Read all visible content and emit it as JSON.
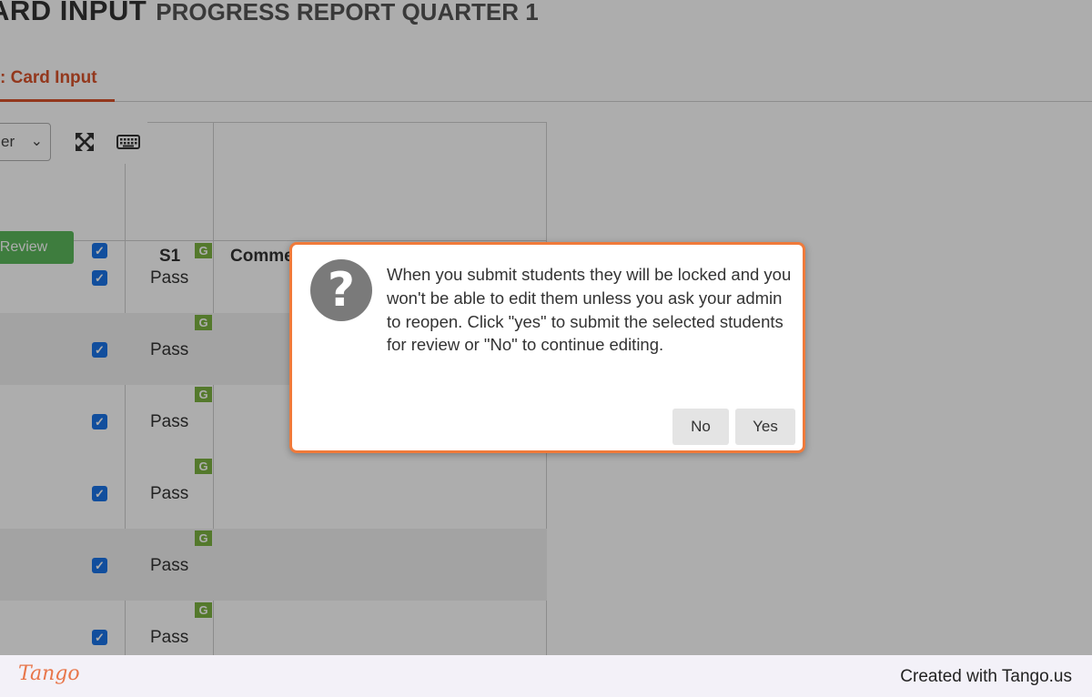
{
  "page": {
    "title_main": "ARD INPUT",
    "title_sub": "PROGRESS REPORT QUARTER 1"
  },
  "tabs": {
    "active_label": ": Card Input"
  },
  "toolbar": {
    "select_value": "er",
    "expand_icon": "expand-icon",
    "keyboard_icon": "keyboard-icon"
  },
  "grid": {
    "review_button_label": "r Review",
    "columns": [
      "S1",
      "Comment"
    ],
    "rows": [
      {
        "tag": "G",
        "value": "Pass"
      },
      {
        "tag": "G",
        "value": "Pass"
      },
      {
        "tag": "G",
        "value": "Pass"
      },
      {
        "tag": "G",
        "value": "Pass"
      },
      {
        "tag": "G",
        "value": "Pass"
      },
      {
        "tag": "G",
        "value": "Pass"
      }
    ]
  },
  "dialog": {
    "icon": "question-icon",
    "message": "When you submit students they will be locked and you won't be able to edit them unless you ask your admin to reopen. Click \"yes\" to submit the selected students for review or \"No\" to continue editing.",
    "no_label": "No",
    "yes_label": "Yes"
  },
  "footer": {
    "brand": "Tango",
    "credit": "Created with Tango.us"
  },
  "colors": {
    "accent": "#d9532c",
    "dialog_border": "#f07a3a",
    "checkbox": "#1a73e8",
    "tag": "#7cb342",
    "review_button": "#5cb85c"
  }
}
